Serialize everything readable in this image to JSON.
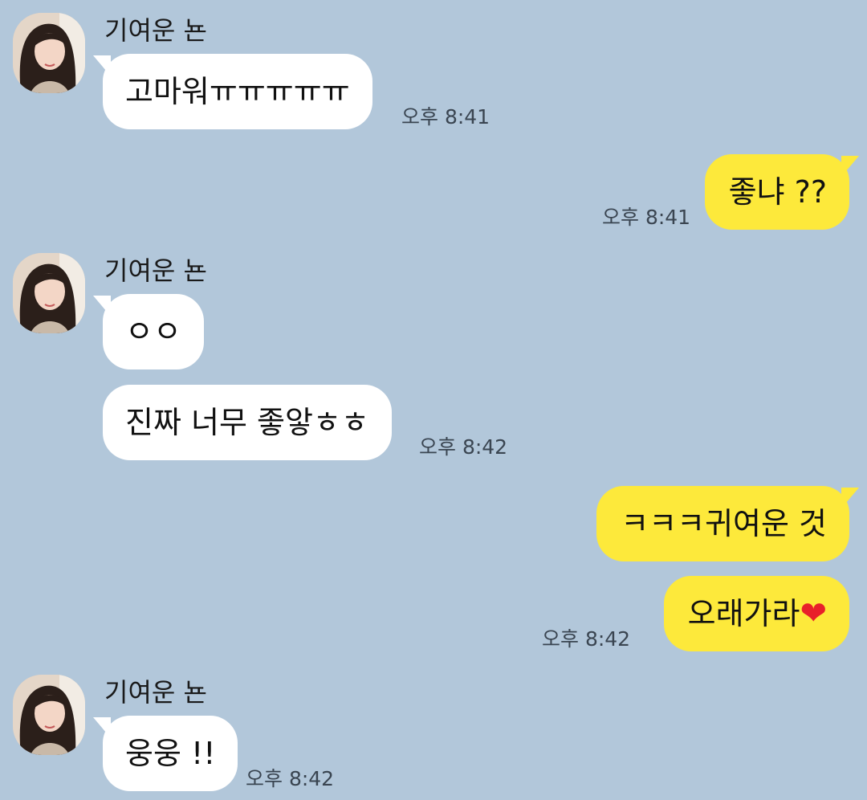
{
  "contact": {
    "name": "기여운 뇬",
    "avatar_icon": "profile-photo"
  },
  "colors": {
    "background": "#b2c7da",
    "incoming_bubble": "#ffffff",
    "outgoing_bubble": "#fde93b",
    "timestamp": "#3a4551"
  },
  "messages": [
    {
      "sender": "contact",
      "text": "고마워ㅠㅠㅠㅠㅠ",
      "time": "오후 8:41"
    },
    {
      "sender": "me",
      "text": "좋냐 ??",
      "time": "오후 8:41"
    },
    {
      "sender": "contact",
      "text": "ㅇㅇ"
    },
    {
      "sender": "contact",
      "text": "진짜 너무 좋앟ㅎㅎ",
      "time": "오후 8:42"
    },
    {
      "sender": "me",
      "text": "ㅋㅋㅋ귀여운 것"
    },
    {
      "sender": "me",
      "text": "오래가라",
      "emoji": "❤",
      "time": "오후 8:42"
    },
    {
      "sender": "contact",
      "text": "웅웅 !!",
      "time": "오후 8:42"
    }
  ]
}
